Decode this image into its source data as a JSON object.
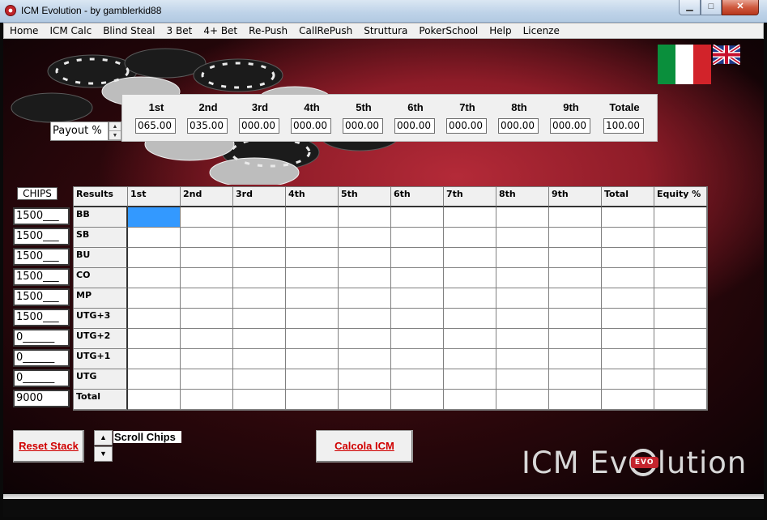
{
  "window": {
    "title": "ICM Evolution - by gamblerkid88",
    "min_glyph": "▁",
    "max_glyph": "□",
    "close_glyph": "✕"
  },
  "menu": [
    "Home",
    "ICM Calc",
    "Blind Steal",
    "3 Bet",
    "4+ Bet",
    "Re-Push",
    "CallRePush",
    "Struttura",
    "PokerSchool",
    "Help",
    "Licenze"
  ],
  "payout": {
    "selector": "Payout %",
    "columns": [
      "1st",
      "2nd",
      "3rd",
      "4th",
      "5th",
      "6th",
      "7th",
      "8th",
      "9th",
      "Totale"
    ],
    "values": [
      "065.00",
      "035.00",
      "000.00",
      "000.00",
      "000.00",
      "000.00",
      "000.00",
      "000.00",
      "000.00",
      "100.00"
    ]
  },
  "chips": {
    "header": "CHIPS",
    "values": [
      "1500___",
      "1500___",
      "1500___",
      "1500___",
      "1500___",
      "1500___",
      "0______",
      "0______",
      "0______"
    ],
    "total": "9000"
  },
  "results": {
    "headers": [
      "Results",
      "1st",
      "2nd",
      "3rd",
      "4th",
      "5th",
      "6th",
      "7th",
      "8th",
      "9th",
      "Total",
      "Equity %"
    ],
    "rows": [
      "BB",
      "SB",
      "BU",
      "CO",
      "MP",
      "UTG+3",
      "UTG+2",
      "UTG+1",
      "UTG",
      "Total"
    ]
  },
  "buttons": {
    "reset": "Reset Stack",
    "scroll": "Scroll Chips",
    "calc": "Calcola ICM",
    "up": "▲",
    "down": "▼"
  },
  "logo": {
    "left": "ICM Ev",
    "badge": "EVO",
    "right": "lution"
  },
  "colors": {
    "accent_red": "#d00000",
    "selection": "#3399ff"
  }
}
